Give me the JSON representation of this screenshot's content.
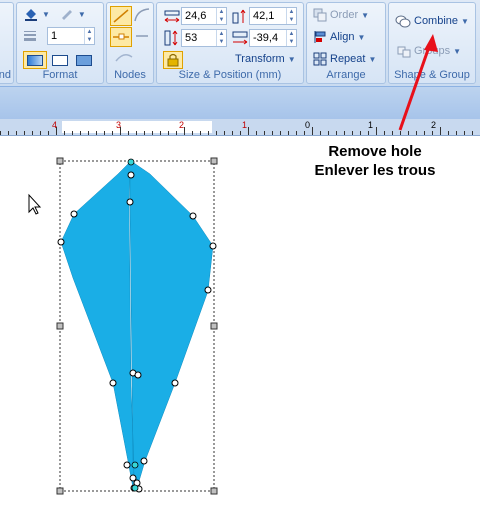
{
  "ribbon": {
    "partial_left_label": "nd",
    "format": {
      "label": "Format",
      "line_width_value": "1"
    },
    "nodes": {
      "label": "Nodes"
    },
    "size_position": {
      "label": "Size & Position (mm)",
      "width": "24,6",
      "x": "42,1",
      "height": "53",
      "y": "-39,4",
      "transform_label": "Transform"
    },
    "arrange": {
      "label": "Arrange",
      "order_label": "Order",
      "align_label": "Align",
      "repeat_label": "Repeat"
    },
    "shape_group": {
      "label": "Shape & Group",
      "combine_label": "Combine",
      "groups_label": "Groups"
    }
  },
  "ruler": {
    "labels": [
      "4",
      "3",
      "2",
      "1",
      "0",
      "1",
      "2"
    ]
  },
  "canvas": {
    "caption_line1": "Remove hole",
    "caption_line2": "Enlever les trous",
    "shape_color": "#1aaee6"
  },
  "colors": {
    "annotation_arrow": "#e8101a"
  }
}
